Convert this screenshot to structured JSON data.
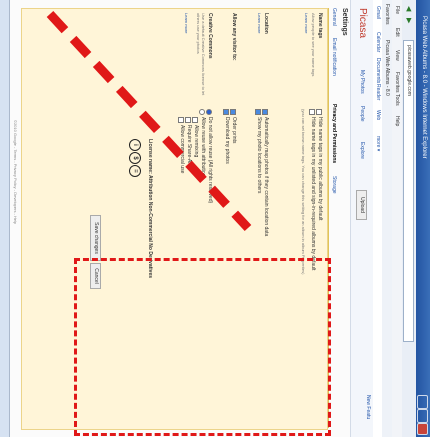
{
  "window": {
    "title": "Picasa Web Albums - 8.0 - Windows Internet Explorer",
    "address": "picasaweb.google.com"
  },
  "menu": {
    "items": [
      "File",
      "Edit",
      "View",
      "Favorites",
      "Tools",
      "Help"
    ]
  },
  "favorites": {
    "label": "Favorites",
    "item": "Picasa Web Albums - 8.0"
  },
  "google_bar": {
    "links": [
      "Gmail",
      "Calendar",
      "Documents",
      "Reader",
      "Web",
      "more ▾"
    ]
  },
  "picasa": {
    "logo": "Picasa",
    "nav": [
      "My Photos",
      "People",
      "Explore"
    ],
    "upload": "Upload",
    "user_link": "New Featu"
  },
  "settings": {
    "title": "Settings",
    "tabs": [
      "General",
      "Email notification",
      "Privacy and Permissions",
      "Storage"
    ],
    "active_tab": "Privacy and Permissions",
    "name_tags": {
      "label": "Name tags",
      "desc": "Allow people to see your name tags",
      "learn": "Learn more",
      "options": [
        "Hide name tags in my public albums by default",
        "Hide name tags in my unlisted and sign-in-required albums by default"
      ],
      "note": "(you can set known name tags. You can change this setting for an album in album Properties)"
    },
    "location": {
      "label": "Location",
      "learn": "Learn more",
      "options": [
        "Automatically map photos if they contain location data",
        "Show my photo locations to others"
      ]
    },
    "visitors": {
      "label": "Allow any visitor to:",
      "options": [
        "Order prints",
        "Download my photos"
      ]
    },
    "creative_commons": {
      "label": "Creative Commons",
      "desc": "Use a default Creative Commons license to let others use your photos",
      "learn": "Learn more",
      "radio_options": [
        "Do not allow reuse (All rights reserved)",
        "Allow reuse with attribution"
      ],
      "checkbox_options": [
        "Allow remixing",
        "Require Share-Alike",
        "Allow commercial use"
      ],
      "license_line": "License name: Attribution Non-Commercial No Derivatives"
    },
    "save_label": "Save changes",
    "cancel_label": "Cancel"
  },
  "footer": "©2010 Google - Terms - Privacy Policy - Developers - Help",
  "colors": {
    "highlight": "#e01818",
    "panel": "#fff5d8",
    "link": "#2255aa"
  }
}
